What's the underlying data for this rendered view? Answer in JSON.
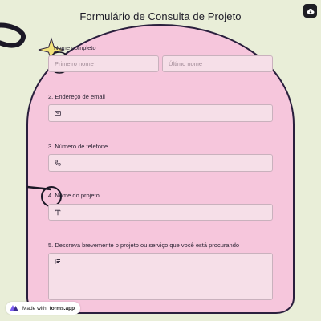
{
  "form": {
    "title": "Formulário de Consulta de Projeto",
    "fields": [
      {
        "label": "Nome completo",
        "first_placeholder": "Primeiro nome",
        "last_placeholder": "Último nome"
      },
      {
        "label": "2. Endereço de email",
        "icon": "mail-icon"
      },
      {
        "label": "3. Número de telefone",
        "icon": "phone-icon"
      },
      {
        "label": "4. Nome do projeto",
        "icon": "text-icon"
      },
      {
        "label": "5. Descreva brevemente o projeto ou serviço que você está procurando",
        "icon": "list-icon"
      }
    ]
  },
  "badge": {
    "prefix": "Made with",
    "brand": "forms.app"
  },
  "colors": {
    "background": "#e9eed8",
    "arch": "#f6c6dc",
    "outline": "#2a1f3d",
    "star": "#f2e27a"
  }
}
